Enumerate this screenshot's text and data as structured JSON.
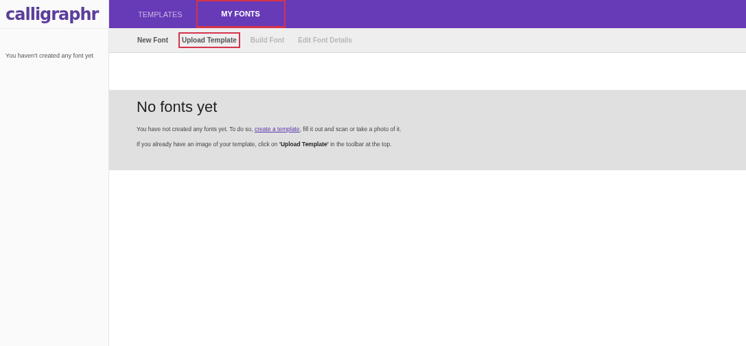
{
  "logo": {
    "text": "calligraphr"
  },
  "sidebar": {
    "message": "You haven't created any font yet"
  },
  "tabs": [
    {
      "label": "TEMPLATES",
      "selected": false,
      "highlighted": false
    },
    {
      "label": "MY FONTS",
      "selected": true,
      "highlighted": true
    }
  ],
  "toolbar": [
    {
      "label": "New Font",
      "disabled": false,
      "highlighted": false
    },
    {
      "label": "Upload Template",
      "disabled": false,
      "highlighted": true
    },
    {
      "label": "Build Font",
      "disabled": true,
      "highlighted": false
    },
    {
      "label": "Edit Font Details",
      "disabled": true,
      "highlighted": false
    }
  ],
  "empty_state": {
    "title": "No fonts yet",
    "intro": {
      "before": "You have not created any fonts yet. To do so,",
      "link": "create a template",
      "after": ", fill it out and scan or take a photo of it."
    },
    "hint": "If you already have an image of your template, click on **'Upload Template'** in the toolbar at the top."
  }
}
